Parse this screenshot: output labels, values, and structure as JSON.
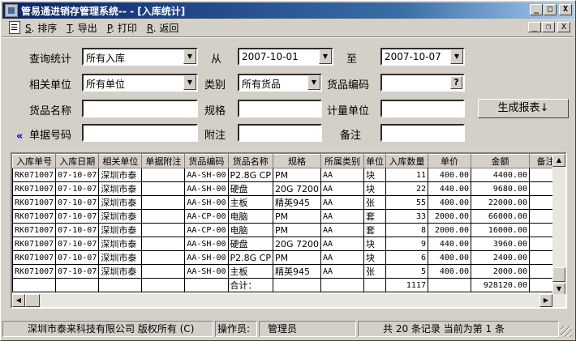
{
  "window": {
    "title": "管易通进销存管理系统-- - [入库统计]",
    "btn_minimize": "_",
    "btn_maximize": "□",
    "btn_close": "X",
    "mdi_minimize": "_",
    "mdi_restore": "❐",
    "mdi_close": "X"
  },
  "menu": [
    {
      "key": "S",
      "label": ". 排序"
    },
    {
      "key": "T",
      "label": ". 导出"
    },
    {
      "key": "P",
      "label": ". 打印"
    },
    {
      "key": "R",
      "label": ". 返回"
    }
  ],
  "filters": {
    "query_label": "查询统计",
    "query_value": "所有入库",
    "from_label": "从",
    "from_value": "2007-10-01",
    "to_label": "至",
    "to_value": "2007-10-07",
    "unit_label": "相关单位",
    "unit_value": "所有单位",
    "category_label": "类别",
    "category_value": "所有货品",
    "code_label": "货品编码",
    "code_value": "",
    "code_lookup": "?",
    "name_label": "货品名称",
    "name_value": "",
    "spec_label": "规格",
    "spec_value": "",
    "measure_label": "计量单位",
    "measure_value": "",
    "docno_label": "单据号码",
    "docno_value": "",
    "note_label": "附注",
    "note_value": "",
    "remark_label": "备注",
    "remark_value": "",
    "generate_label": "生成报表↓",
    "collapse_label": "«"
  },
  "grid": {
    "columns": [
      "入库单号",
      "入库日期",
      "相关单位",
      "单据附注",
      "货品编码",
      "货品名称",
      "规格",
      "所属类别",
      "单位",
      "入库数量",
      "单价",
      "金额",
      "备注"
    ],
    "rows": [
      [
        "RK071007",
        "07-10-07",
        "深圳市泰",
        "",
        "AA-SH-00",
        "P2.8G CP",
        "PM",
        "AA",
        "块",
        "11",
        "400.00",
        "4400.00",
        ""
      ],
      [
        "RK071007",
        "07-10-07",
        "深圳市泰",
        "",
        "AA-SH-00",
        "硬盘",
        "20G 7200",
        "AA",
        "块",
        "22",
        "440.00",
        "9680.00",
        ""
      ],
      [
        "RK071007",
        "07-10-07",
        "深圳市泰",
        "",
        "AA-SH-00",
        "主板",
        "精英945",
        "AA",
        "张",
        "55",
        "400.00",
        "22000.00",
        ""
      ],
      [
        "RK071007",
        "07-10-07",
        "深圳市泰",
        "",
        "AA-CP-00",
        "电脑",
        "PM",
        "AA",
        "套",
        "33",
        "2000.00",
        "66000.00",
        ""
      ],
      [
        "RK071007",
        "07-10-07",
        "深圳市泰",
        "",
        "AA-CP-00",
        "电脑",
        "PM",
        "AA",
        "套",
        "8",
        "2000.00",
        "16000.00",
        ""
      ],
      [
        "RK071007",
        "07-10-07",
        "深圳市泰",
        "",
        "AA-SH-00",
        "硬盘",
        "20G 7200",
        "AA",
        "块",
        "9",
        "440.00",
        "3960.00",
        ""
      ],
      [
        "RK071007",
        "07-10-07",
        "深圳市泰",
        "",
        "AA-SH-00",
        "P2.8G CP",
        "PM",
        "AA",
        "块",
        "6",
        "400.00",
        "2400.00",
        ""
      ],
      [
        "RK071007",
        "07-10-07",
        "深圳市泰",
        "",
        "AA-SH-00",
        "主板",
        "精英945",
        "AA",
        "张",
        "5",
        "400.00",
        "2000.00",
        ""
      ]
    ],
    "total_label": "合计：",
    "total_qty": "1117",
    "total_amount": "928120.00"
  },
  "status": {
    "copyright": "深圳市泰来科技有限公司 版权所有 (C)",
    "operator_label": "操作员:",
    "operator_value": "管理员",
    "records": "共 20 条记录 当前为第 1 条"
  }
}
